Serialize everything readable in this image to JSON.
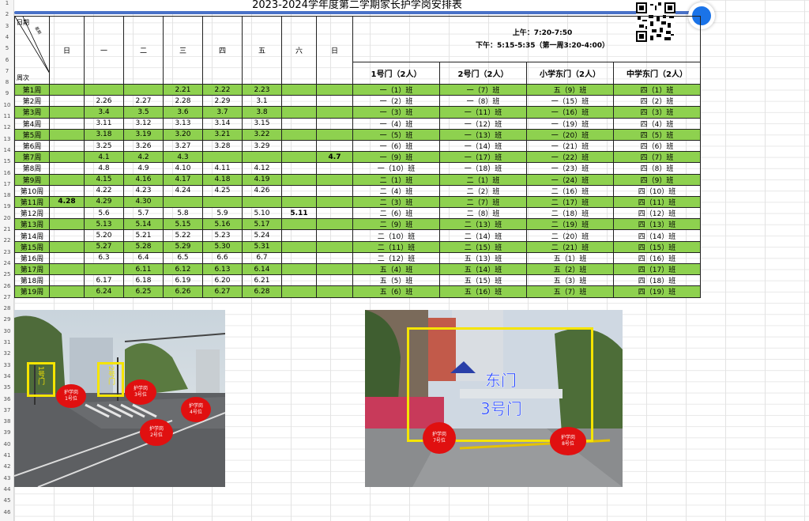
{
  "title": "2023-2024学年度第二学期家长护学岗安排表",
  "header": {
    "corner_day": "日期",
    "corner_week": "周次",
    "corner_diag": "星期",
    "weekdays": [
      "日",
      "一",
      "二",
      "三",
      "四",
      "五",
      "六",
      "日"
    ],
    "time_am": "上午：7:20-7:50",
    "time_pm": "下午：5:15-5:35（第一周3:20-4:00）",
    "gates": [
      "1号门（2人）",
      "2号门（2人）",
      "小学东门（2人）",
      "中学东门（2人）"
    ]
  },
  "rows": [
    {
      "w": "第1周",
      "d": [
        "",
        "",
        "",
        "2.21",
        "2.22",
        "2.23",
        "",
        ""
      ],
      "g": [
        "一（1）班",
        "一（7）班",
        "五（9）班",
        "四（1）班"
      ],
      "c": 1
    },
    {
      "w": "第2周",
      "d": [
        "",
        "2.26",
        "2.27",
        "2.28",
        "2.29",
        "3.1",
        "",
        ""
      ],
      "g": [
        "一（2）班",
        "一（8）班",
        "一（15）班",
        "四（2）班"
      ],
      "c": 0
    },
    {
      "w": "第3周",
      "d": [
        "",
        "3.4",
        "3.5",
        "3.6",
        "3.7",
        "3.8",
        "",
        ""
      ],
      "g": [
        "一（3）班",
        "一（11）班",
        "一（16）班",
        "四（3）班"
      ],
      "c": 1
    },
    {
      "w": "第4周",
      "d": [
        "",
        "3.11",
        "3.12",
        "3.13",
        "3.14",
        "3.15",
        "",
        ""
      ],
      "g": [
        "一（4）班",
        "一（12）班",
        "一（19）班",
        "四（4）班"
      ],
      "c": 0
    },
    {
      "w": "第5周",
      "d": [
        "",
        "3.18",
        "3.19",
        "3.20",
        "3.21",
        "3.22",
        "",
        ""
      ],
      "g": [
        "一（5）班",
        "一（13）班",
        "一（20）班",
        "四（5）班"
      ],
      "c": 1
    },
    {
      "w": "第6周",
      "d": [
        "",
        "3.25",
        "3.26",
        "3.27",
        "3.28",
        "3.29",
        "",
        ""
      ],
      "g": [
        "一（6）班",
        "一（14）班",
        "一（21）班",
        "四（6）班"
      ],
      "c": 0
    },
    {
      "w": "第7周",
      "d": [
        "",
        "4.1",
        "4.2",
        "4.3",
        "",
        "",
        "",
        "4.7"
      ],
      "g": [
        "一（9）班",
        "一（17）班",
        "一（22）班",
        "四（7）班"
      ],
      "c": 1
    },
    {
      "w": "第8周",
      "d": [
        "",
        "4.8",
        "4.9",
        "4.10",
        "4.11",
        "4.12",
        "",
        ""
      ],
      "g": [
        "一（10）班",
        "一（18）班",
        "一（23）班",
        "四（8）班"
      ],
      "c": 0
    },
    {
      "w": "第9周",
      "d": [
        "",
        "4.15",
        "4.16",
        "4.17",
        "4.18",
        "4.19",
        "",
        ""
      ],
      "g": [
        "二（1）班",
        "二（1）班",
        "一（24）班",
        "四（9）班"
      ],
      "c": 1
    },
    {
      "w": "第10周",
      "d": [
        "",
        "4.22",
        "4.23",
        "4.24",
        "4.25",
        "4.26",
        "",
        ""
      ],
      "g": [
        "二（4）班",
        "二（2）班",
        "二（16）班",
        "四（10）班"
      ],
      "c": 0
    },
    {
      "w": "第11周",
      "d": [
        "4.28",
        "4.29",
        "4.30",
        "",
        "",
        "",
        "",
        ""
      ],
      "g": [
        "二（3）班",
        "二（7）班",
        "二（17）班",
        "四（11）班"
      ],
      "c": 1
    },
    {
      "w": "第12周",
      "d": [
        "",
        "5.6",
        "5.7",
        "5.8",
        "5.9",
        "5.10",
        "5.11",
        ""
      ],
      "g": [
        "二（6）班",
        "二（8）班",
        "二（18）班",
        "四（12）班"
      ],
      "c": 0
    },
    {
      "w": "第13周",
      "d": [
        "",
        "5.13",
        "5.14",
        "5.15",
        "5.16",
        "5.17",
        "",
        ""
      ],
      "g": [
        "二（9）班",
        "二（13）班",
        "二（19）班",
        "四（13）班"
      ],
      "c": 1
    },
    {
      "w": "第14周",
      "d": [
        "",
        "5.20",
        "5.21",
        "5.22",
        "5.23",
        "5.24",
        "",
        ""
      ],
      "g": [
        "二（10）班",
        "二（14）班",
        "二（20）班",
        "四（14）班"
      ],
      "c": 0
    },
    {
      "w": "第15周",
      "d": [
        "",
        "5.27",
        "5.28",
        "5.29",
        "5.30",
        "5.31",
        "",
        ""
      ],
      "g": [
        "二（11）班",
        "二（15）班",
        "二（21）班",
        "四（15）班"
      ],
      "c": 1
    },
    {
      "w": "第16周",
      "d": [
        "",
        "6.3",
        "6.4",
        "6.5",
        "6.6",
        "6.7",
        "",
        ""
      ],
      "g": [
        "二（12）班",
        "五（13）班",
        "五（1）班",
        "四（16）班"
      ],
      "c": 0
    },
    {
      "w": "第17周",
      "d": [
        "",
        "",
        "6.11",
        "6.12",
        "6.13",
        "6.14",
        "",
        ""
      ],
      "g": [
        "五（4）班",
        "五（14）班",
        "五（2）班",
        "四（17）班"
      ],
      "c": 1
    },
    {
      "w": "第18周",
      "d": [
        "",
        "6.17",
        "6.18",
        "6.19",
        "6.20",
        "6.21",
        "",
        ""
      ],
      "g": [
        "五（5）班",
        "五（15）班",
        "五（3）班",
        "四（18）班"
      ],
      "c": 0
    },
    {
      "w": "第19周",
      "d": [
        "",
        "6.24",
        "6.25",
        "6.26",
        "6.27",
        "6.28",
        "",
        ""
      ],
      "g": [
        "五（6）班",
        "五（16）班",
        "五（7）班",
        "四（19）班"
      ],
      "c": 1
    }
  ],
  "photo1": {
    "labels": [
      "1号门",
      "2号门"
    ],
    "circles": [
      "护学岗\n1号位",
      "护学岗\n3号位",
      "护学岗\n4号位",
      "护学岗\n2号位"
    ]
  },
  "photo2": {
    "gate_label_1": "东门",
    "gate_label_2": "3号门",
    "circles": [
      "护学岗\n7号位",
      "护学岗\n8号位"
    ]
  }
}
